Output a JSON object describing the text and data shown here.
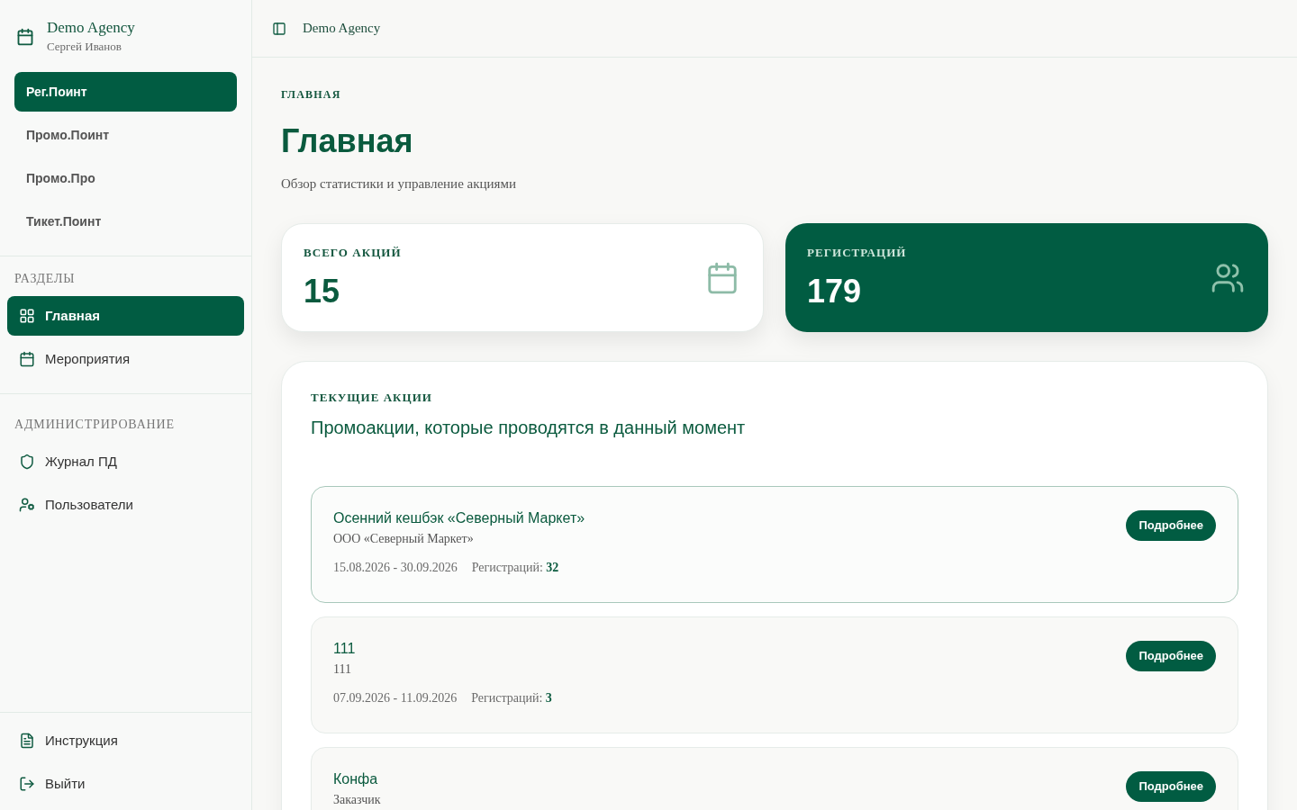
{
  "sidebar": {
    "brand": {
      "title": "Demo Agency",
      "subtitle": "Сергей Иванов"
    },
    "products": [
      {
        "label": "Рег.Поинт",
        "selected": true
      },
      {
        "label": "Промо.Поинт",
        "selected": false
      },
      {
        "label": "Промо.Про",
        "selected": false
      },
      {
        "label": "Тикет.Поинт",
        "selected": false
      }
    ],
    "sections": [
      {
        "title": "РАЗДЕЛЫ",
        "items": [
          {
            "label": "Главная",
            "selected": true
          },
          {
            "label": "Мероприятия",
            "selected": false
          }
        ]
      },
      {
        "title": "АДМИНИСТРИРОВАНИЕ",
        "items": [
          {
            "label": "Журнал ПД",
            "selected": false
          },
          {
            "label": "Пользователи",
            "selected": false
          }
        ]
      }
    ],
    "footer_items": [
      {
        "label": "Инструкция"
      },
      {
        "label": "Выйти"
      }
    ]
  },
  "header": {
    "title": "Demo Agency"
  },
  "page": {
    "eyebrow": "ГЛАВНАЯ",
    "title": "Главная",
    "subtitle": "Обзор статистики и управление акциями"
  },
  "stats": [
    {
      "kind": "light",
      "label": "ВСЕГО АКЦИЙ",
      "value": "15"
    },
    {
      "kind": "dark",
      "label": "РЕГИСТРАЦИЙ",
      "value": "179"
    }
  ],
  "promotions": {
    "eyebrow": "ТЕКУЩИЕ АКЦИИ",
    "title": "Промоакции, которые проводятся в данный момент",
    "items": [
      {
        "title": "Осенний кешбэк «Северный Маркет»",
        "client": "ООО «Северный Маркет»",
        "dates": "15.08.2026 - 30.09.2026",
        "registrations": "Регистраций: **32**",
        "button": "Подробнее",
        "selected": true
      },
      {
        "title": "111",
        "client": "111",
        "dates": "07.09.2026 - 11.09.2026",
        "registrations": "Регистраций: **3**",
        "button": "Подробнее",
        "selected": false
      },
      {
        "title": "Конфа",
        "client": "Заказчик",
        "button": "Подробнее",
        "selected": false
      }
    ]
  }
}
